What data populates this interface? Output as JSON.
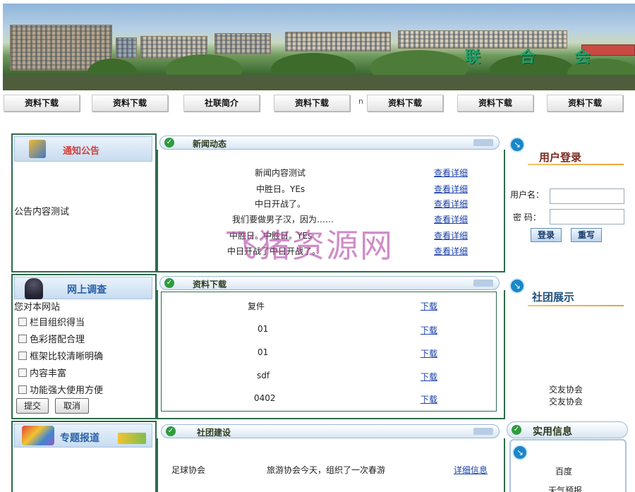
{
  "banner": {
    "title": "联 合 会"
  },
  "nav": {
    "items": [
      "资料下载",
      "资料下载",
      "社联简介",
      "资料下载",
      "资料下载",
      "资料下载",
      "资料下载"
    ],
    "separator": "n"
  },
  "notice": {
    "title": "通知公告",
    "content": "公告内容测试"
  },
  "news": {
    "title": "新闻动态",
    "items": [
      {
        "text": "新闻内容测试",
        "link": "查看详细"
      },
      {
        "text": "中胜日。YEs",
        "link": "查看详细"
      },
      {
        "text": "中日开战了。",
        "link": "查看详细"
      },
      {
        "text": "我们要做男子汉，因为……",
        "link": "查看详细"
      },
      {
        "text": "中胜日。中胜日。YEs",
        "link": "查看详细"
      },
      {
        "text": "中日开战了中日开战了。",
        "link": "查看详细"
      }
    ]
  },
  "login": {
    "title": "用户登录",
    "username_label": "用户名：",
    "password_label": "密  码：",
    "login_button": "登录",
    "reset_button": "重写"
  },
  "survey": {
    "title": "网上调查",
    "question": "您对本网站",
    "options": [
      "栏目组织得当",
      "色彩搭配合理",
      "框架比较清晰明确",
      "内容丰富",
      "功能强大使用方便"
    ],
    "submit": "提交",
    "cancel": "取消"
  },
  "downloads": {
    "title": "资料下载",
    "items": [
      {
        "name": "复件",
        "link": "下载"
      },
      {
        "name": "01",
        "link": "下载"
      },
      {
        "name": "01",
        "link": "下载"
      },
      {
        "name": "sdf",
        "link": "下载"
      },
      {
        "name": "0402",
        "link": "下载"
      }
    ]
  },
  "clubs": {
    "title": "社团展示",
    "items": [
      "交友协会",
      "交友协会"
    ]
  },
  "special": {
    "title": "专题报道"
  },
  "club_build": {
    "title": "社团建设",
    "row": {
      "name": "足球协会",
      "desc": "旅游协会今天，组织了一次春游",
      "link": "详细信息"
    }
  },
  "useful": {
    "title": "实用信息",
    "items": [
      "百度",
      "天气预报"
    ]
  },
  "watermark": "飞猪资源网",
  "colors": {
    "border": "#2e6b4c",
    "link": "#1a3fa8",
    "banner_title": "#23a06a"
  }
}
